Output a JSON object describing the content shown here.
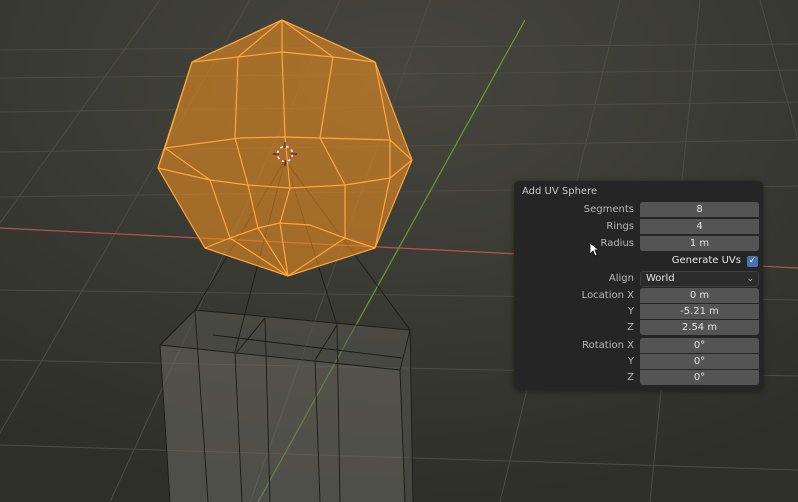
{
  "panel": {
    "title": "Add UV Sphere",
    "segments": {
      "label": "Segments",
      "value": "8"
    },
    "rings": {
      "label": "Rings",
      "value": "4"
    },
    "radius": {
      "label": "Radius",
      "value": "1 m"
    },
    "generate_uvs": {
      "label": "Generate UVs",
      "checked": true,
      "check_glyph": "✓"
    },
    "align": {
      "label": "Align",
      "value": "World",
      "arrow": "⌄"
    },
    "location": {
      "label_x": "Location X",
      "label_y": "Y",
      "label_z": "Z",
      "x": "0 m",
      "y": "-5.21 m",
      "z": "2.54 m"
    },
    "rotation": {
      "label_x": "Rotation X",
      "label_y": "Y",
      "label_z": "Z",
      "x": "0°",
      "y": "0°",
      "z": "0°"
    }
  },
  "colors": {
    "selection": "#f7941d",
    "axis_x": "#b5524a",
    "axis_y": "#6c9a2e",
    "accent": "#4772b3"
  }
}
